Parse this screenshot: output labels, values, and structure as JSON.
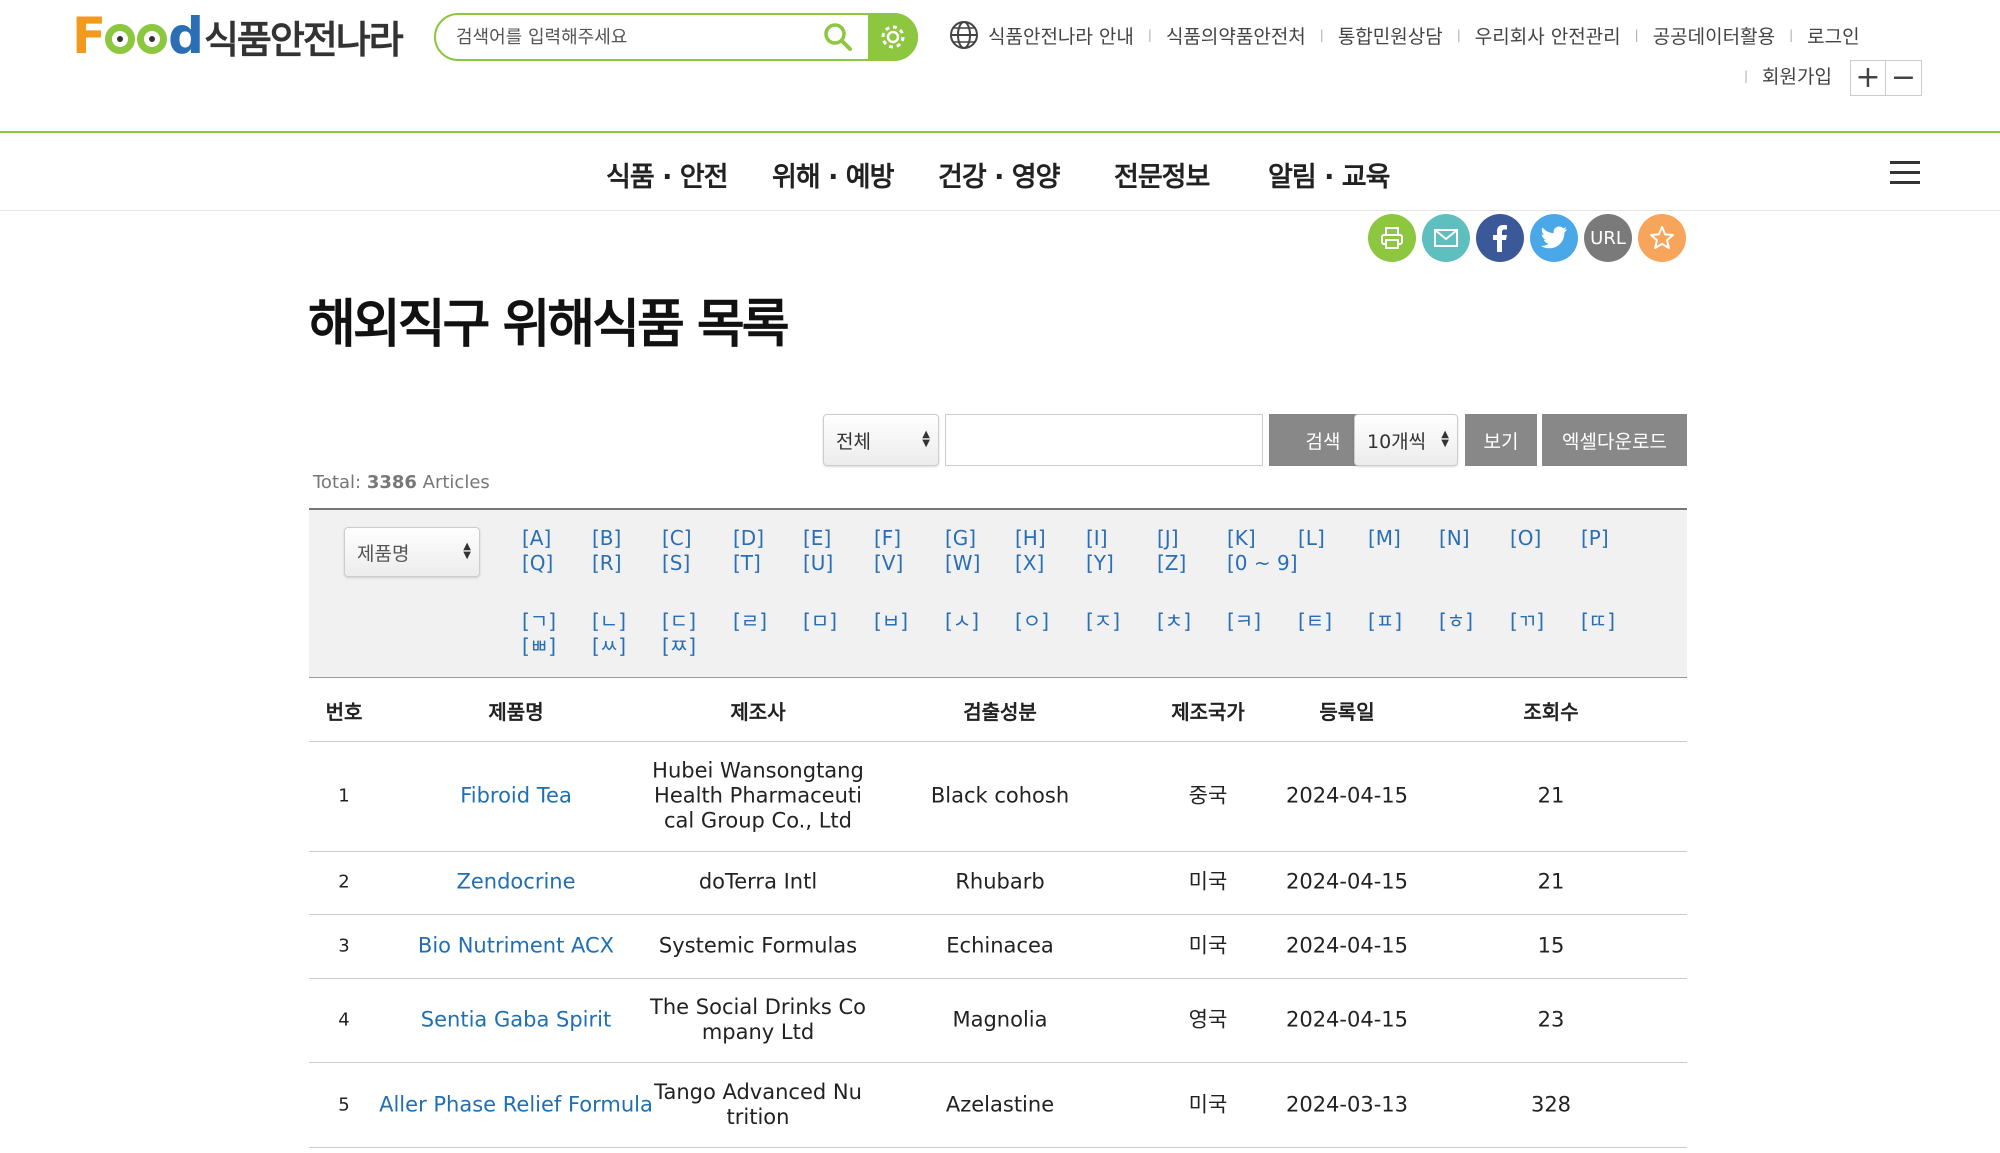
{
  "header": {
    "logo_text": "Food",
    "logo_kor": "식품안전나라",
    "search_placeholder": "검색어를 입력해주세요",
    "util_links": [
      "식품안전나라 안내",
      "식품의약품안전처",
      "통합민원상담",
      "우리회사 안전관리",
      "공공데이터활용",
      "로그인"
    ],
    "signup": "회원가입",
    "zoom_in": "+",
    "zoom_out": "−"
  },
  "nav": [
    "식품 · 안전",
    "위해 · 예방",
    "건강 · 영양",
    "전문정보",
    "알림 · 교육"
  ],
  "share": {
    "url_label": "URL"
  },
  "page_title": "해외직구 위해식품 목록",
  "search": {
    "scope_select": "전체",
    "search_button": "검색",
    "perpage_select": "10개씩",
    "view_button": "보기",
    "excel_button": "엑셀다운로드",
    "total_prefix": "Total: ",
    "total_count": "3386",
    "total_suffix": " Articles"
  },
  "filter": {
    "field_select": "제품명",
    "alpha": [
      "[A]",
      "[B]",
      "[C]",
      "[D]",
      "[E]",
      "[F]",
      "[G]",
      "[H]",
      "[I]",
      "[J]",
      "[K]",
      "[L]",
      "[M]",
      "[N]",
      "[O]",
      "[P]",
      "[Q]",
      "[R]",
      "[S]",
      "[T]",
      "[U]",
      "[V]",
      "[W]",
      "[X]",
      "[Y]",
      "[Z]",
      "[0 ~ 9]"
    ],
    "korean": [
      "[ㄱ]",
      "[ㄴ]",
      "[ㄷ]",
      "[ㄹ]",
      "[ㅁ]",
      "[ㅂ]",
      "[ㅅ]",
      "[ㅇ]",
      "[ㅈ]",
      "[ㅊ]",
      "[ㅋ]",
      "[ㅌ]",
      "[ㅍ]",
      "[ㅎ]",
      "[ㄲ]",
      "[ㄸ]",
      "[ㅃ]",
      "[ㅆ]",
      "[ㅉ]"
    ]
  },
  "table": {
    "columns": [
      "번호",
      "제품명",
      "제조사",
      "검출성분",
      "제조국가",
      "등록일",
      "조회수"
    ],
    "rows": [
      {
        "no": "1",
        "product": "Fibroid Tea",
        "maker": [
          "Hubei Wansongtang",
          "Health Pharmaceuti",
          "cal Group Co., Ltd"
        ],
        "ingredient": "Black cohosh",
        "country": "중국",
        "date": "2024-04-15",
        "views": "21"
      },
      {
        "no": "2",
        "product": "Zendocrine",
        "maker": [
          "doTerra Intl"
        ],
        "ingredient": "Rhubarb",
        "country": "미국",
        "date": "2024-04-15",
        "views": "21"
      },
      {
        "no": "3",
        "product": "Bio Nutriment ACX",
        "maker": [
          "Systemic Formulas"
        ],
        "ingredient": "Echinacea",
        "country": "미국",
        "date": "2024-04-15",
        "views": "15"
      },
      {
        "no": "4",
        "product": "Sentia Gaba Spirit",
        "maker": [
          "The Social Drinks Co",
          "mpany Ltd"
        ],
        "ingredient": "Magnolia",
        "country": "영국",
        "date": "2024-04-15",
        "views": "23"
      },
      {
        "no": "5",
        "product": "Aller Phase Relief Formula",
        "maker": [
          "Tango Advanced Nu",
          "trition"
        ],
        "ingredient": "Azelastine",
        "country": "미국",
        "date": "2024-03-13",
        "views": "328"
      }
    ]
  },
  "colors": {
    "brand_green": "#8dc63f",
    "link_blue": "#1f6fb2",
    "button_gray": "#888888"
  }
}
